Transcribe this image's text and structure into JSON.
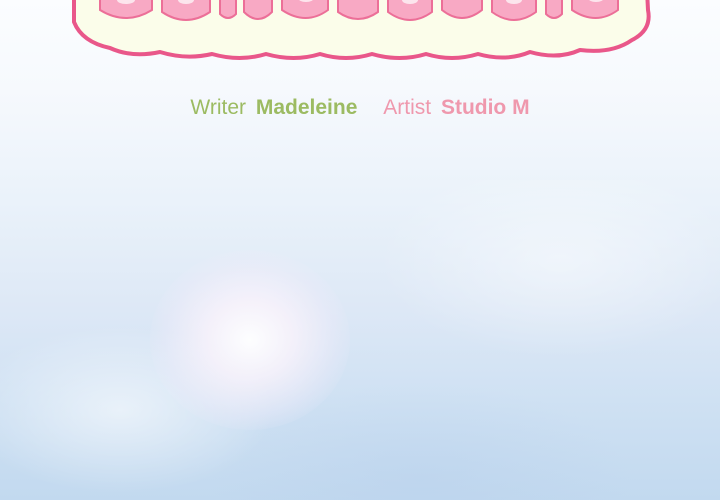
{
  "colors": {
    "writer": "#9cbb62",
    "artist": "#ef98ad",
    "logo_fill": "#fbfdea",
    "logo_outline": "#e9578a",
    "logo_letters": "#f8a9c4"
  },
  "logo": {
    "icon": "title-logo-cropped"
  },
  "credits": {
    "writer_role": "Writer",
    "writer_name": "Madeleine",
    "artist_role": "Artist",
    "artist_name": "Studio M"
  }
}
